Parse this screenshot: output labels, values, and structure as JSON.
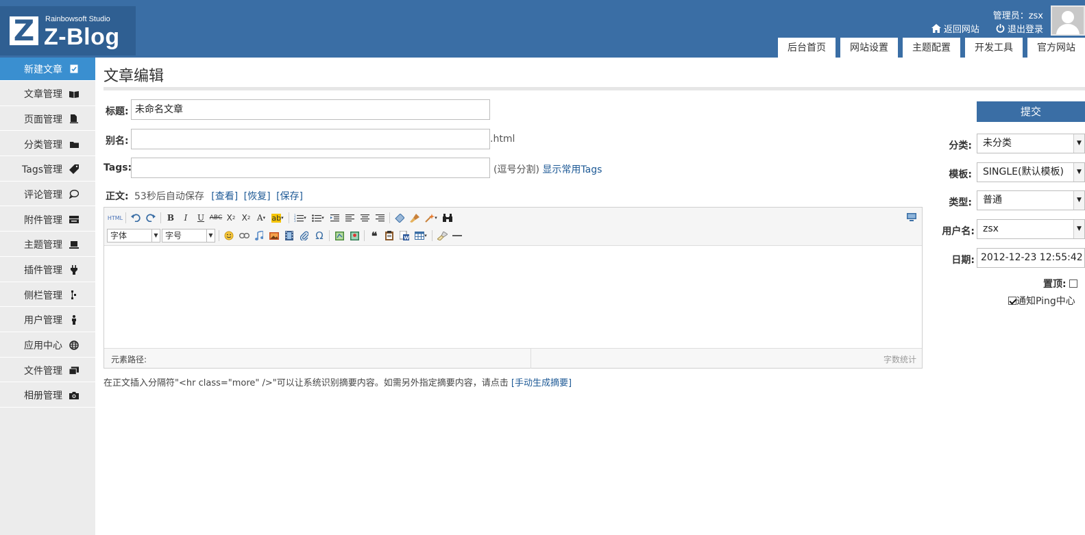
{
  "header": {
    "logo_studio": "Rainbowsoft Studio",
    "logo_name": "Z-Blog",
    "logo_letter": "Z",
    "admin_label": "管理员：zsx",
    "back_to_site": "返回网站",
    "logout": "退出登录",
    "tabs": [
      "后台首页",
      "网站设置",
      "主题配置",
      "开发工具",
      "官方网站"
    ]
  },
  "sidebar": {
    "items": [
      {
        "label": "新建文章",
        "icon": "edit-check-icon"
      },
      {
        "label": "文章管理",
        "icon": "book-icon"
      },
      {
        "label": "页面管理",
        "icon": "page-icon"
      },
      {
        "label": "分类管理",
        "icon": "folder-icon"
      },
      {
        "label": "Tags管理",
        "icon": "tag-icon"
      },
      {
        "label": "评论管理",
        "icon": "comment-icon"
      },
      {
        "label": "附件管理",
        "icon": "attachment-icon"
      },
      {
        "label": "主题管理",
        "icon": "laptop-icon"
      },
      {
        "label": "插件管理",
        "icon": "plug-icon"
      },
      {
        "label": "侧栏管理",
        "icon": "sidebar-icon"
      },
      {
        "label": "用户管理",
        "icon": "user-icon"
      },
      {
        "label": "应用中心",
        "icon": "globe-icon"
      },
      {
        "label": "文件管理",
        "icon": "files-icon"
      },
      {
        "label": "相册管理",
        "icon": "camera-icon"
      }
    ]
  },
  "main": {
    "page_title": "文章编辑",
    "title_label": "标题:",
    "title_value": "未命名文章",
    "alias_label": "别名:",
    "alias_value": "",
    "alias_suffix": ".html",
    "tags_label": "Tags:",
    "tags_value": "",
    "tags_hint": "(逗号分割)",
    "tags_link": "显示常用Tags",
    "body_label": "正文:",
    "autosave_text": "53秒后自动保存",
    "view_link": "[查看]",
    "restore_link": "[恢复]",
    "save_link": "[保存]",
    "editor": {
      "html_btn": "HTML",
      "font_select": "字体",
      "size_select": "字号",
      "path_label": "元素路径:",
      "word_count": "字数统计"
    },
    "footer_tip": "在正文插入分隔符\"<hr class=\"more\" />\"可以让系统识别摘要内容。如需另外指定摘要内容，请点击",
    "footer_link": "[手动生成摘要]"
  },
  "panel": {
    "submit": "提交",
    "category_label": "分类:",
    "category_value": "未分类",
    "template_label": "模板:",
    "template_value": "SINGLE(默认模板)",
    "type_label": "类型:",
    "type_value": "普通",
    "user_label": "用户名:",
    "user_value": "zsx",
    "date_label": "日期:",
    "date_value": "2012-12-23 12:55:42",
    "top_label": "置顶:",
    "ping_label": "通知Ping中心"
  },
  "colors": {
    "header_bg": "#3a6ea5",
    "active_item": "#3a8fd0",
    "sidebar_bg": "#ececec"
  }
}
